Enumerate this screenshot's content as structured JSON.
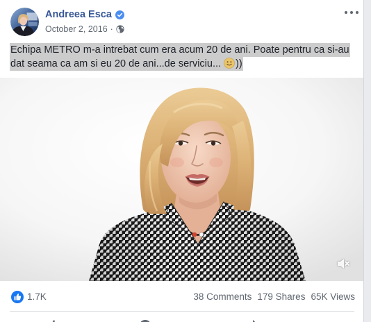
{
  "post": {
    "author_name": "Andreea Esca",
    "verified": true,
    "date": "October 2, 2016",
    "separator": "·",
    "text_lines": [
      "Echipa METRO m-a intrebat cum era acum 20 de ani. Poate pentru ca si-au",
      "dat seama ca am si eu 20 de ani...de serviciu... "
    ],
    "text_end": "))",
    "icons": {
      "avatar": "profile-photo",
      "verified": "verified-badge-icon",
      "privacy": "globe-icon",
      "more": "more-options-icon",
      "emoji": "smile-emoji-icon"
    }
  },
  "video": {
    "muted": true,
    "icons": {
      "volume": "muted-speaker-icon"
    }
  },
  "stats": {
    "reaction_icon": "like-reaction-icon",
    "reactions": "1.7K",
    "comments": "38 Comments",
    "shares": "179 Shares",
    "views": "65K Views"
  },
  "actions": {
    "icons": [
      "like-icon",
      "comment-icon",
      "share-icon"
    ]
  },
  "colors": {
    "author_link": "#385898",
    "text": "#1d2129",
    "secondary_text": "#606770",
    "selection_highlight": "#cccccc",
    "like_blue": "#1877f2",
    "verified_blue": "#4b8ef1",
    "divider": "#dadde1",
    "card_background": "#ffffff",
    "page_background": "#e9ebee"
  }
}
